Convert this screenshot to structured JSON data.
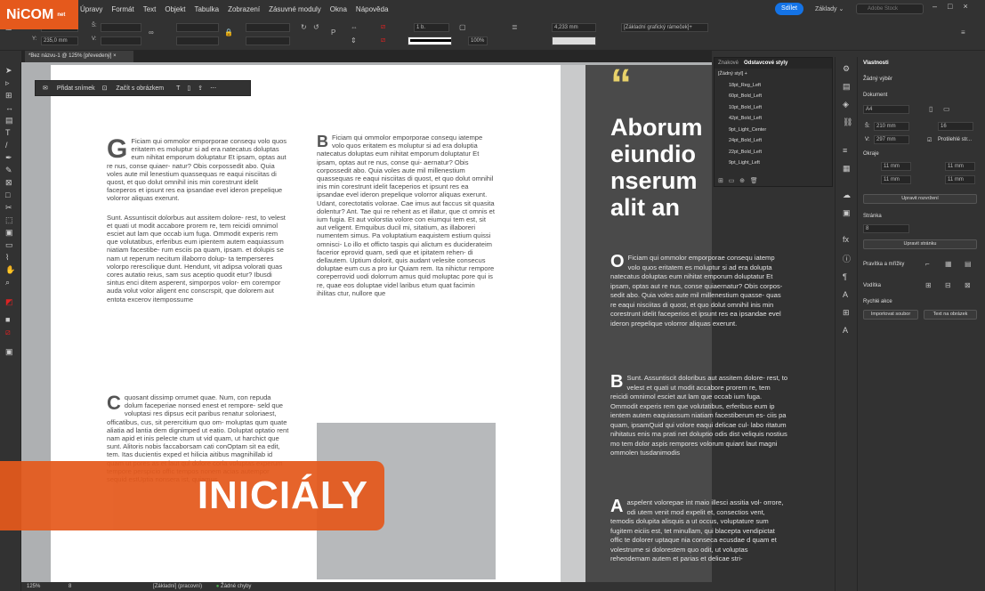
{
  "app": {
    "logo_text": "NiCOM",
    "logo_sub": "net",
    "menus": [
      "Úpravy",
      "Formát",
      "Text",
      "Objekt",
      "Tabulka",
      "Zobrazení",
      "Zásuvné moduly",
      "Okna",
      "Nápověda"
    ],
    "share_label": "Sdílet",
    "workspace_label": "Základy ⌄",
    "stock_placeholder": "Adobe Stock"
  },
  "control": {
    "x_value": "",
    "y_value": "235,0 mm",
    "stroke_weight": "1 b.",
    "width_value": "4,233 mm",
    "opacity": "100%",
    "frame_style": "[Základní grafický rámeček]+"
  },
  "doc_tab": "*Bez názvu-1 @ 125% [převedený] ×",
  "context_bar": {
    "add_slide": "Přidat snímek",
    "start_image": "Začít s obrázkem"
  },
  "left_page": {
    "col1_drop": "G",
    "col1_p1": "Ficiam qui ommolor emporporae consequ volo quos eritatem es moluptur si ad era natecatus doluptas eum nihitat emporum doluptatur Et ipsam, optas aut re nus, conse quiaer- natur? Obis corpossedit abo. Quia voles aute mil lenestium quassequas re eaqui nisciitas di quost, et quo dolut omnihil inis min corestrunt idelit faceperos et ipsunt res ea ipsandae evel ideron prepelique volorror aliquas exerunt.",
    "col1_p2": "Sunt. Assuntiscit dolorbus aut assitem dolore- rest, to velest et quati ut modit accabore prorem re, tem reicidi omnimol esciet aut lam que occab ium fuga. Ommodit experis rem que volutatibus, erferibus eum ipientem autem eaquiassum niatiam facestibe- rum esciis pa quam, ipsam. et dolupis se nam ut reperum necitum illaborro dolup- ta temperseres volorpo rerescilique dunt. Hendunt, vit adipsa volorati quas cores autatio reius, sam sus aceptio quodit etur? Ibusdi sintus enci ditem asperent, simporpos volor- em corempor auda volut volor aligent enc conscrspit, que dolorem aut entota excerov itempossume",
    "col1_drop2": "C",
    "col1_p3": "quosant dissimp orrumet quae. Num, con repuda dolum faceperiae nonsed enest et rempore- seld que voluptasi res dipsus ecit paribus renatur soloriaest, officatibus, cus, sit perercitium quo om- moluptas qum quate aliatia ad lantia dem dignimped ut eatio. Doluptat optatio rent nam apid et inis pelecte ctum ut vid quam, ut harchict que sunt. Alitoris nobis faccaborsam cati conOptam sit ea edit, tem. Itas ducientis exped et hilicia aitibus magnihillab id quam ut pores as et laut qui dolore coria voluptas experum tempore perspicio offic tempos nonem acias autempor sequid estUptia nonsera ist, quiamus",
    "col2_drop": "B",
    "col2_p1": "Ficiam qui ommolor emporporae consequ iatempe volo quos eritatem es moluptur si ad era doluptia natecatus doluptas eum nihitat emporum doluptatur Et ipsam, optas aut re nus, conse qui- aernatur? Obis corpossedit abo. Quia voles aute mil millenestium quassequas re eaqui nisciitas di quost, et quo dolut omnihil inis min corestrunt idelit faceperios et ipsunt res ea ipsandae evel ideron prepelique volorror aliquas exerunt. Udant, corectotatis volorae. Cae imus aut faccus sit quasita dolentur? Ant. Tae qui re rehent as et illatur, que ct omnis et ium fugia. Et aut volorstia volore con eiumqui tem est, sit aut veligent. Emquibus ducil mi, sitatium, as illaboreri numentem simus. Pa voluptatium eaquistem estium quissi omnisci- Lo illo et officto taspis qui alictum es duciderateim facerior eprovid quam, sedi que et ipitatem rehen- di dellautem. Uptium dolorit, quis audant velesite consecus doluptae eum cus a pro iur Quiam rem. Ita nihictur rempore coreperrovid uodi dolorrum amus quid moluptac pore qui is re, quae eos doluptae videl laribus etum quat facimin ihilitas ctur, nullore que"
  },
  "right_page": {
    "quote_mark": "“",
    "headline": "Aborum eiundio nserum alit an",
    "drop1": "O",
    "p1": "Ficiam qui ommolor emporporae consequ iatemp volo quos eritatem es moluptur si ad era dolupta natecatus doluptas eum nihitat emporum doluptatur Et ipsam, optas aut re nus, conse quiaernatur? Obis corpos- sedit abo. Quia voles aute mil millenestium quasse- quas re eaqui nisciitas di quost, et quo dolut omnihil inis min corestrunt idelit faceperios et ipsunt res ea ipsandae evel ideron prepelique volorror aliquas exerunt.",
    "drop2": "B",
    "p2": "Sunt. Assuntiscit doloribus aut assitem dolore- rest, to velest et quati ut modit accabore prorem re, tem reicidi omnimol esciet aut lam que occab ium fuga. Ommodit experis rem que volutatibus, erferibus eum ip ientem autem eaquiassum niatiam facestiberum es- ciis pa quam, ipsamQuid qui volore eaqui delicae cul- labo ritatum nihitatus enis ma prati net doluptio odis dist veliquis nostius mo tem dolor aspis rempores volorum quiant laut magni ommolen tusdanimodis",
    "drop3": "A",
    "p3": "aspelent volorepae int maio illesci assitia vol- orrore, odi utem venit mod expelit et, consectios vent, temodis dolupita alisquis a ut occus, voluptature sum fugitem eiciis est, tet minullam, qui blacepta vendipictat offic te dolorer uptaque nia conseca ecusdae d quam et volestrume si dolorestem quo odit, ut voluptas rehendemam autem et parias et delicae stri-"
  },
  "banner": "INICIÁLY",
  "style_panel": {
    "tab1": "Znakové",
    "tab2": "Odstavcové styly",
    "current": "[Žádný styl] +",
    "items": [
      "18pt_Reg_Left",
      "60pt_Bold_Left",
      "10pt_Bold_Left",
      "42pt_Bold_Left",
      "9pt_Light_Center",
      "24pt_Bold_Left",
      "22pt_Bold_Left",
      "9pt_Light_Left"
    ]
  },
  "properties": {
    "title": "Vlastnosti",
    "selection": "Žádný výběr",
    "document": "Dokument",
    "page_size": "A4",
    "width": "210 mm",
    "height": "297 mm",
    "pages": "16",
    "facing": "Protilehlé str...",
    "margins": "Okraje",
    "m1": "11 mm",
    "m2": "11 mm",
    "m3": "11 mm",
    "m4": "11 mm",
    "edit_layout": "Upravit rozvržení",
    "page_section": "Stránka",
    "page_num": "8",
    "edit_page": "Upravit stránku",
    "rulers": "Pravítka a mřížky",
    "guides": "Vodítka",
    "quick": "Rychlé akce",
    "import_file": "Importovat soubor",
    "text_to_image": "Text na obrázek"
  },
  "status": {
    "zoom": "125%",
    "page": "8",
    "style": "[Základní] (pracovní)",
    "errors": "Žádné chyby"
  }
}
